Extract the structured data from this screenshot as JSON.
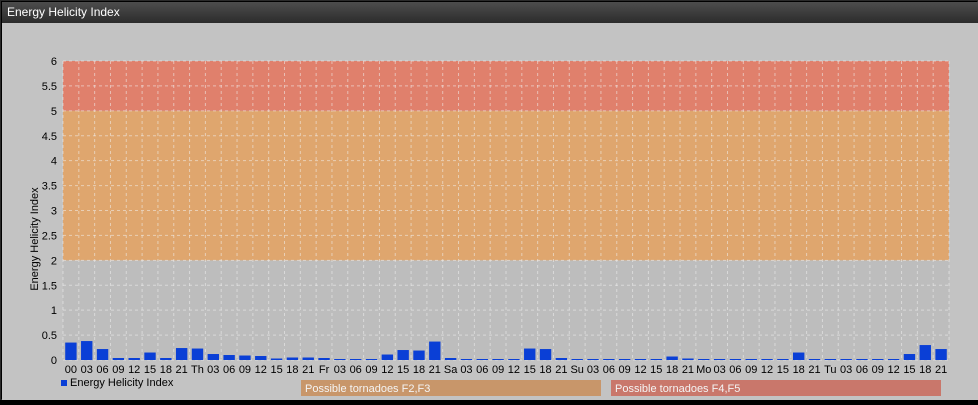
{
  "window": {
    "title": "Energy Helicity Index"
  },
  "colors": {
    "bar": "#0a3fd6",
    "band_low": "#bdbdbd",
    "band_mid": "#dfa66e",
    "band_high": "#e0806c",
    "legend_mid": "#c8966a",
    "legend_high": "#c9776b"
  },
  "legend": {
    "series_label": "Energy Helicity Index",
    "band_mid_label": "Possible tornadoes F2,F3",
    "band_high_label": "Possible tornadoes F4,F5"
  },
  "chart_data": {
    "type": "bar",
    "title": "",
    "ylabel": "Energy Helicity Index",
    "xlabel": "",
    "ylim": [
      0,
      6
    ],
    "yticks": [
      0,
      0.5,
      1,
      1.5,
      2,
      2.5,
      3,
      3.5,
      4,
      4.5,
      5,
      5.5,
      6
    ],
    "grid": true,
    "bands": [
      {
        "from": 0,
        "to": 2,
        "label": ""
      },
      {
        "from": 2,
        "to": 5,
        "label": "Possible tornadoes F2,F3"
      },
      {
        "from": 5,
        "to": 6,
        "label": "Possible tornadoes F4,F5"
      }
    ],
    "categories": [
      "00",
      "03",
      "06",
      "09",
      "12",
      "15",
      "18",
      "21",
      "Th",
      "03",
      "06",
      "09",
      "12",
      "15",
      "18",
      "21",
      "Fr",
      "03",
      "06",
      "09",
      "12",
      "15",
      "18",
      "21",
      "Sa",
      "03",
      "06",
      "09",
      "12",
      "15",
      "18",
      "21",
      "Su",
      "03",
      "06",
      "09",
      "12",
      "15",
      "18",
      "21",
      "Mo",
      "03",
      "06",
      "09",
      "12",
      "15",
      "18",
      "21",
      "Tu",
      "03",
      "06",
      "09",
      "12",
      "15",
      "18",
      "21"
    ],
    "series": [
      {
        "name": "Energy Helicity Index",
        "values": [
          0.35,
          0.38,
          0.22,
          0.04,
          0.04,
          0.15,
          0.04,
          0.24,
          0.23,
          0.12,
          0.1,
          0.09,
          0.08,
          0.03,
          0.05,
          0.05,
          0.04,
          0.02,
          0.02,
          0.02,
          0.11,
          0.2,
          0.19,
          0.37,
          0.04,
          0.02,
          0.02,
          0.02,
          0.02,
          0.23,
          0.22,
          0.04,
          0.02,
          0.02,
          0.02,
          0.02,
          0.02,
          0.02,
          0.07,
          0.03,
          0.02,
          0.02,
          0.02,
          0.02,
          0.02,
          0.02,
          0.15,
          0.02,
          0.02,
          0.02,
          0.02,
          0.02,
          0.02,
          0.12,
          0.3,
          0.22
        ]
      }
    ]
  }
}
